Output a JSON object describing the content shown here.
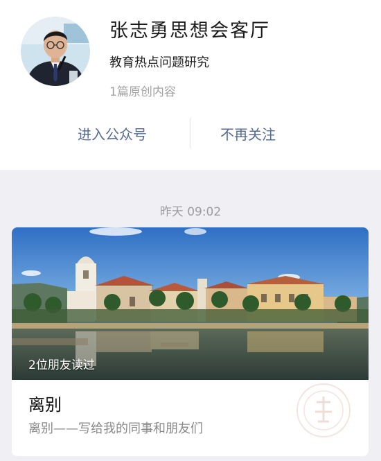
{
  "account": {
    "name": "张志勇思想会客厅",
    "description": "教育热点问题研究",
    "original_count": "1篇原创内容"
  },
  "actions": {
    "enter_label": "进入公众号",
    "unfollow_label": "不再关注"
  },
  "feed": {
    "timestamp": "昨天 09:02",
    "article": {
      "friends_read": "2位朋友读过",
      "title": "离别",
      "digest": "离别——写给我的同事和朋友们"
    }
  },
  "colors": {
    "link": "#576b95",
    "page_background": "#efeff4"
  }
}
